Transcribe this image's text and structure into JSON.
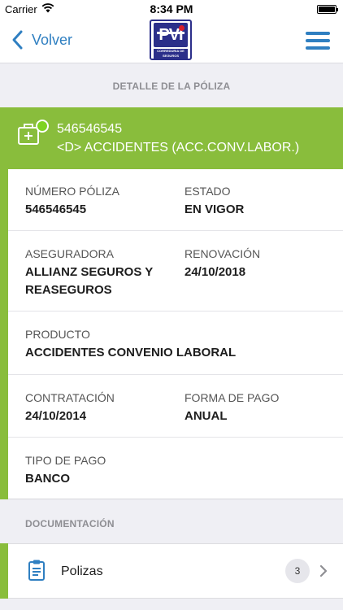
{
  "status_bar": {
    "carrier": "Carrier",
    "time": "8:34 PM"
  },
  "nav": {
    "back_label": "Volver",
    "logo_text": "PVI",
    "logo_band_text": "CORREDURIA DE SEGUROS"
  },
  "section_detail_title": "DETALLE DE LA PÓLIZA",
  "policy": {
    "number": "546546545",
    "name": "<D> ACCIDENTES (ACC.CONV.LABOR.)",
    "status_indicator": "green-dot"
  },
  "fields": {
    "numero_poliza": {
      "label": "NÚMERO PÓLIZA",
      "value": "546546545"
    },
    "estado": {
      "label": "ESTADO",
      "value": "EN VIGOR"
    },
    "aseguradora": {
      "label": "ASEGURADORA",
      "value": "ALLIANZ SEGUROS Y REASEGUROS"
    },
    "renovacion": {
      "label": "RENOVACIÓN",
      "value": "24/10/2018"
    },
    "producto": {
      "label": "PRODUCTO",
      "value": "ACCIDENTES CONVENIO LABORAL"
    },
    "contratacion": {
      "label": "CONTRATACIÓN",
      "value": "24/10/2014"
    },
    "forma_pago": {
      "label": "FORMA DE PAGO",
      "value": "ANUAL"
    },
    "tipo_pago": {
      "label": "TIPO DE PAGO",
      "value": "BANCO"
    }
  },
  "section_docs_title": "DOCUMENTACIÓN",
  "documents": [
    {
      "label": "Polizas",
      "count": "3",
      "icon": "clipboard-icon"
    }
  ],
  "colors": {
    "accent_green": "#89bd3c",
    "link_blue": "#2f7fc1",
    "logo_navy": "#2b2f8a",
    "logo_red": "#d81e2a"
  }
}
